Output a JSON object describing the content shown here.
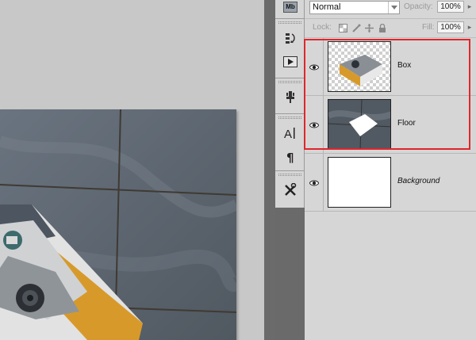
{
  "layers_panel": {
    "blend_mode": "Normal",
    "opacity_label": "Opacity:",
    "opacity_value": "100%",
    "lock_label": "Lock:",
    "fill_label": "Fill:",
    "fill_value": "100%",
    "layers": [
      {
        "name": "Box",
        "visible": true,
        "thumb": "box-with-transparency"
      },
      {
        "name": "Floor",
        "visible": true,
        "thumb": "floor-with-cutout"
      },
      {
        "name": "Background",
        "visible": true,
        "thumb": "white",
        "italic": true
      }
    ]
  },
  "tool_strip": {
    "icons": [
      "mini-bridge-icon",
      "history-icon",
      "actions-play-icon",
      "clone-source-icon",
      "character-icon",
      "paragraph-icon",
      "tool-presets-icon"
    ],
    "mini_bridge_label": "Mb"
  },
  "canvas": {
    "content": "photo-box-on-floor"
  },
  "colors": {
    "highlight": "#e0262c",
    "panel_bg": "#d6d6d6",
    "workspace_bg": "#c8c8c8"
  }
}
